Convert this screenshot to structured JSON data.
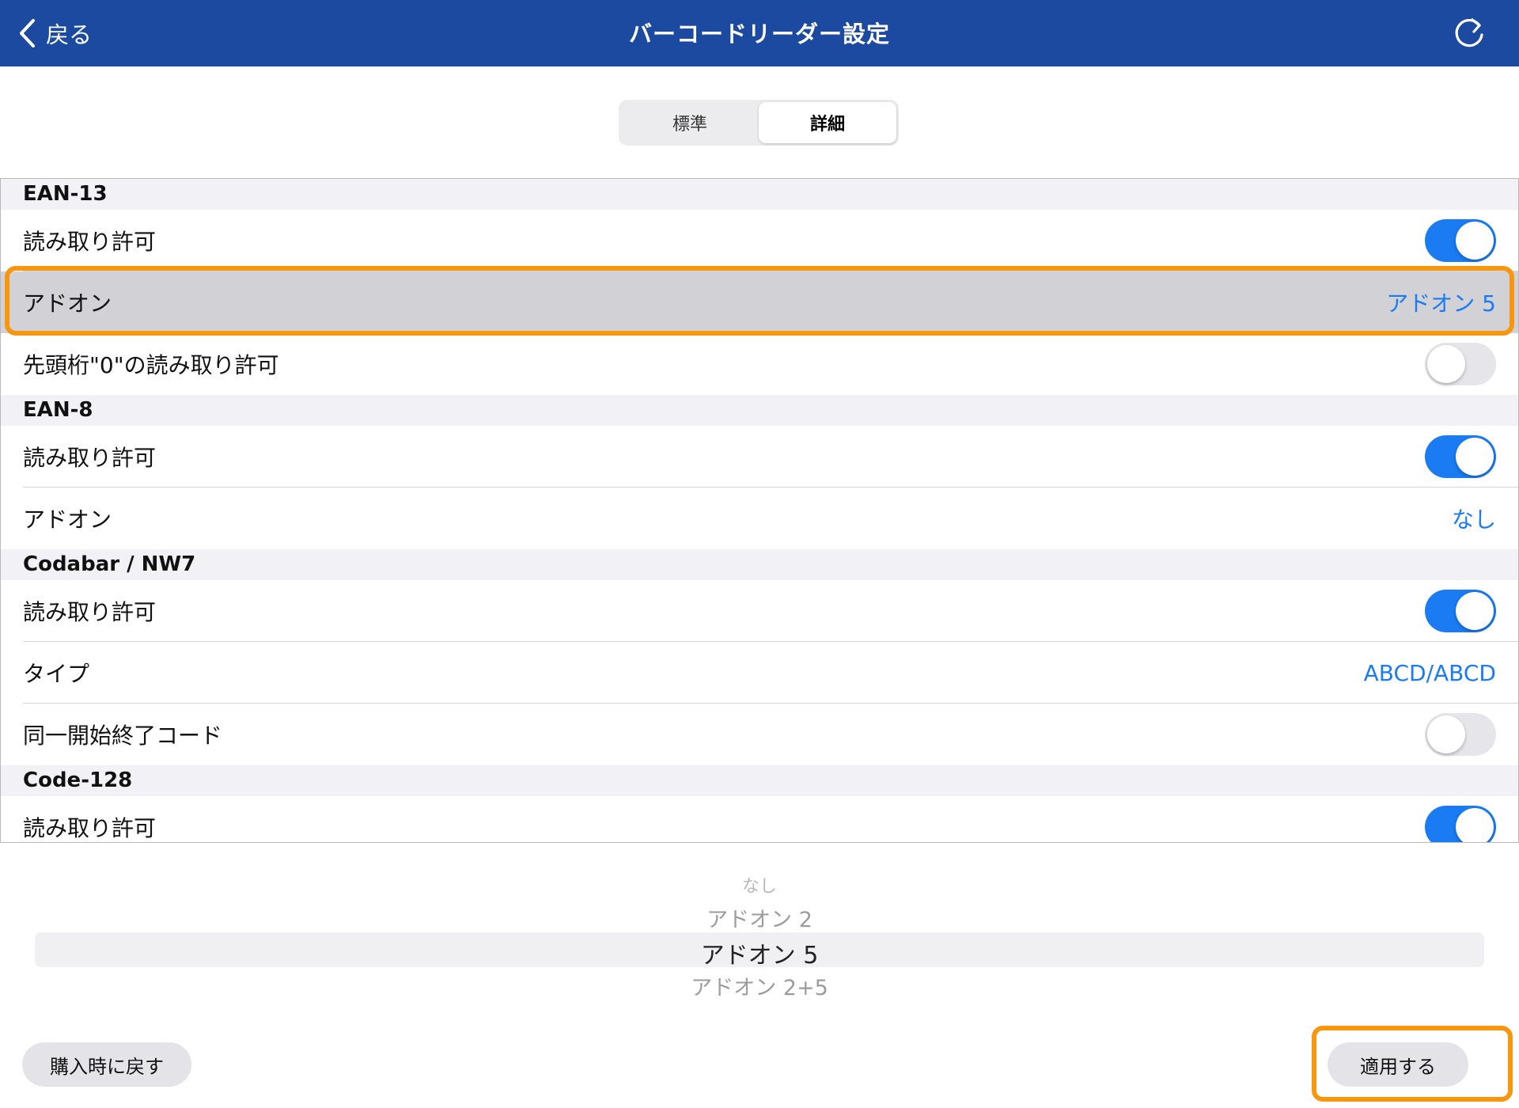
{
  "header": {
    "back_label": "戻る",
    "title": "バーコードリーダー設定",
    "refresh_icon": "refresh-icon"
  },
  "segment": {
    "tabs": [
      {
        "label": "標準",
        "active": false
      },
      {
        "label": "詳細",
        "active": true
      }
    ]
  },
  "sections": [
    {
      "title": "EAN-13",
      "rows": [
        {
          "label": "読み取り許可",
          "type": "toggle",
          "on": true
        },
        {
          "label": "アドオン",
          "type": "value",
          "value": "アドオン 5",
          "selected": true
        },
        {
          "label": "先頭桁\"0\"の読み取り許可",
          "type": "toggle",
          "on": false
        }
      ]
    },
    {
      "title": "EAN-8",
      "rows": [
        {
          "label": "読み取り許可",
          "type": "toggle",
          "on": true
        },
        {
          "label": "アドオン",
          "type": "value",
          "value": "なし"
        }
      ]
    },
    {
      "title": "Codabar / NW7",
      "rows": [
        {
          "label": "読み取り許可",
          "type": "toggle",
          "on": true
        },
        {
          "label": "タイプ",
          "type": "value",
          "value": "ABCD/ABCD"
        },
        {
          "label": "同一開始終了コード",
          "type": "toggle",
          "on": false
        }
      ]
    },
    {
      "title": "Code-128",
      "rows": [
        {
          "label": "読み取り許可",
          "type": "toggle",
          "on": true
        }
      ]
    }
  ],
  "picker": {
    "options": [
      "なし",
      "アドオン 2",
      "アドオン 5",
      "アドオン 2+5"
    ],
    "selected": "アドオン 5"
  },
  "buttons": {
    "reset_label": "購入時に戻す",
    "apply_label": "適用する"
  },
  "colors": {
    "header_bg": "#1b4aa0",
    "accent": "#1a7bf2",
    "highlight": "#f7960f"
  }
}
